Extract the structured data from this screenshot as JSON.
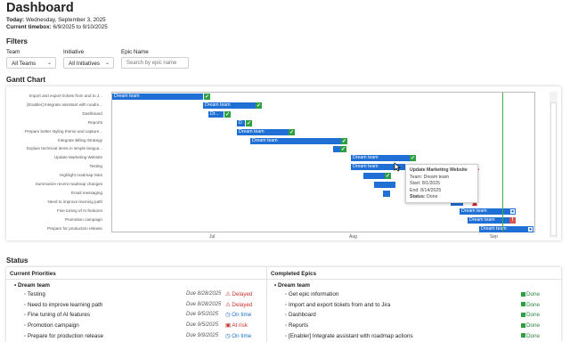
{
  "header": {
    "title": "Dashboard",
    "today_label": "Today:",
    "today_value": "Wednesday, September 3, 2025",
    "timebox_label": "Current timebox:",
    "timebox_value": "6/9/2025 to 9/10/2025"
  },
  "filters": {
    "heading": "Filters",
    "team_label": "Team",
    "team_value": "All Teams",
    "initiative_label": "Initiative",
    "initiative_value": "All Initiatives",
    "epic_label": "Epic Name",
    "epic_placeholder": "Search by epic name"
  },
  "gantt": {
    "heading": "Gantt Chart",
    "rows": [
      {
        "label": "Import and export tickets from and to J...",
        "bar": "Dream team",
        "marker": "done"
      },
      {
        "label": "[Enabler] Integrate assistant with roadm...",
        "bar": "Dream team",
        "marker": "done"
      },
      {
        "label": "Dashboard",
        "bar": "Dr...",
        "marker": "done"
      },
      {
        "label": "Reports",
        "bar": "D",
        "marker": "done"
      },
      {
        "label": "Prepare better styling theme and capture...",
        "bar": "Dream team",
        "marker": "done"
      },
      {
        "label": "Integrate Billing Strategy",
        "bar": "Dream team",
        "marker": "done"
      },
      {
        "label": "Explain technical items in simple langua...",
        "bar": "",
        "marker": "done"
      },
      {
        "label": "Update Marketing Website",
        "bar": "Dream team",
        "marker": "done"
      },
      {
        "label": "Testing",
        "bar": "Dream team",
        "marker": "delayed"
      },
      {
        "label": "Highlight roadmap risks",
        "bar": "",
        "marker": "done"
      },
      {
        "label": "Summarize recent roadmap changes",
        "bar": "",
        "marker": ""
      },
      {
        "label": "Email messaging",
        "bar": "",
        "marker": ""
      },
      {
        "label": "Need to improve learning path",
        "bar": "",
        "marker": "delayed"
      },
      {
        "label": "Fine tuning of AI features",
        "bar": "Dream team",
        "marker": "pending"
      },
      {
        "label": "Promotion campaign",
        "bar": "Dream team",
        "marker": "risk"
      },
      {
        "label": "Prepare for production release",
        "bar": "Dream team",
        "marker": "pending"
      }
    ],
    "x_ticks": [
      "Jul",
      "Aug",
      "Sep"
    ],
    "tooltip": {
      "title": "Update Marketing Website",
      "team_label": "Team:",
      "team_value": "Dream team",
      "start_label": "Start:",
      "start_value": "8/1/2025",
      "end_label": "End:",
      "end_value": "8/14/2025",
      "status_label": "Status:",
      "status_value": "Done"
    },
    "colors": {
      "bar": "#1f6fd4",
      "today_line": "#3cb043",
      "done": "#2ea043",
      "risk": "#d9534f"
    }
  },
  "status": {
    "heading": "Status",
    "current": {
      "header": "Current Priorities",
      "group": "Dream team",
      "items": [
        {
          "name": "Testing",
          "due": "Due 8/28/2025",
          "status": "Delayed"
        },
        {
          "name": "Need to improve learning path",
          "due": "Due 8/28/2025",
          "status": "Delayed"
        },
        {
          "name": "Fine tuning of AI features",
          "due": "Due 9/5/2025",
          "status": "On time"
        },
        {
          "name": "Promotion campaign",
          "due": "Due 9/5/2025",
          "status": "At risk"
        },
        {
          "name": "Prepare for production release",
          "due": "Due 9/9/2025",
          "status": "On time"
        }
      ]
    },
    "completed": {
      "header": "Completed Epics",
      "group": "Dream team",
      "items": [
        {
          "name": "Get epic information",
          "status": "Done"
        },
        {
          "name": "Import and export tickets from and to Jira",
          "status": "Done"
        },
        {
          "name": "Dashboard",
          "status": "Done"
        },
        {
          "name": "Reports",
          "status": "Done"
        },
        {
          "name": "[Enabler] Integrate assistant with roadmap actions",
          "status": "Done"
        }
      ]
    }
  }
}
